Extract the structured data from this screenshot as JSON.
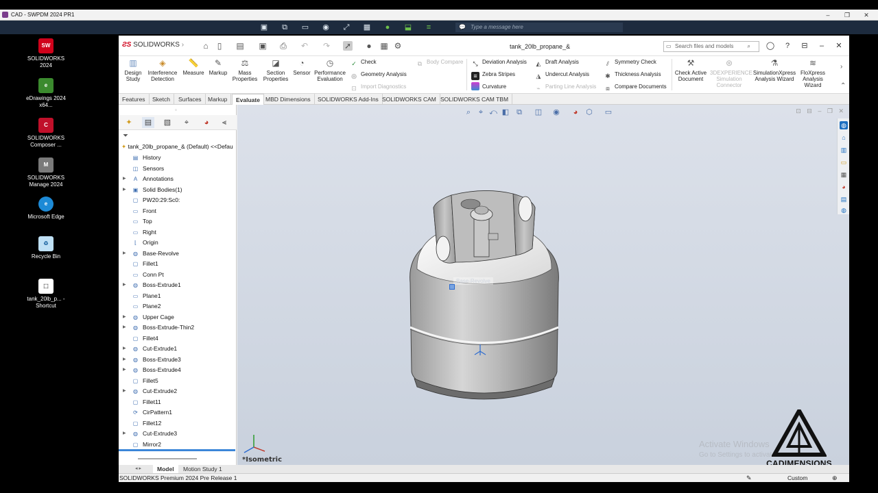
{
  "remote": {
    "title": "CAD - SWPDM 2024 PR1",
    "message_placeholder": "Type a message here"
  },
  "desktop": {
    "icons": [
      {
        "label": "SOLIDWORKS 2024",
        "icon": "solidworks-icon",
        "color": "#d0021b"
      },
      {
        "label": "eDrawings 2024 x64...",
        "icon": "edrawings-icon",
        "color": "#3b8a2e"
      },
      {
        "label": "SOLIDWORKS Composer ...",
        "icon": "composer-icon",
        "color": "#c0102a"
      },
      {
        "label": "SOLIDWORKS Manage 2024",
        "icon": "manage-icon",
        "color": "#7a7a7a"
      },
      {
        "label": "Microsoft Edge",
        "icon": "edge-icon",
        "color": "#1d8ad6"
      },
      {
        "label": "Recycle Bin",
        "icon": "recycle-bin-icon",
        "color": "#bfe0f5"
      },
      {
        "label": "tank_20lb_p... - Shortcut",
        "icon": "shortcut-icon",
        "color": "#ffffff"
      }
    ]
  },
  "sw": {
    "brand": "SOLIDWORKS",
    "doc_title": "tank_20lb_propane_&",
    "search_placeholder": "Search files and models",
    "ribbon": {
      "large": [
        {
          "label": "Design Study",
          "icon": "design-study-icon"
        },
        {
          "label": "Interference Detection",
          "icon": "interference-icon"
        },
        {
          "label": "Measure",
          "icon": "measure-icon"
        },
        {
          "label": "Markup",
          "icon": "markup-icon"
        },
        {
          "label": "Mass Properties",
          "icon": "mass-properties-icon"
        },
        {
          "label": "Section Properties",
          "icon": "section-properties-icon"
        },
        {
          "label": "Sensor",
          "icon": "sensor-icon"
        },
        {
          "label": "Performance Evaluation",
          "icon": "performance-icon"
        }
      ],
      "col1": [
        "Check",
        "Geometry Analysis",
        "Import Diagnostics"
      ],
      "col_dis": "Body Compare",
      "col2": [
        "Deviation Analysis",
        "Zebra Stripes",
        "Curvature"
      ],
      "col3": [
        "Draft Analysis",
        "Undercut Analysis",
        "Parting Line Analysis"
      ],
      "col4": [
        "Symmetry Check",
        "Thickness Analysis",
        "Compare Documents"
      ],
      "right": [
        {
          "label": "Check Active Document",
          "icon": "check-active-icon"
        },
        {
          "label": "3DEXPERIENCE Simulation Connector",
          "icon": "3dx-icon"
        },
        {
          "label": "SimulationXpress Analysis Wizard",
          "icon": "simxpress-icon"
        },
        {
          "label": "FloXpress Analysis Wizard",
          "icon": "floxpress-icon"
        }
      ]
    },
    "cm_tabs": [
      "Features",
      "Sketch",
      "Surfaces",
      "Markup",
      "Evaluate",
      "MBD Dimensions",
      "SOLIDWORKS Add-Ins",
      "SOLIDWORKS CAM",
      "SOLIDWORKS CAM TBM"
    ],
    "tree_root": "tank_20lb_propane_& (Default) <<Defau",
    "tree": [
      {
        "label": "History",
        "exp": false
      },
      {
        "label": "Sensors",
        "exp": false
      },
      {
        "label": "Annotations",
        "exp": true
      },
      {
        "label": "Solid Bodies(1)",
        "exp": true
      },
      {
        "label": "PW20:29:Sc0:",
        "exp": false
      },
      {
        "label": "Front",
        "exp": false
      },
      {
        "label": "Top",
        "exp": false
      },
      {
        "label": "Right",
        "exp": false
      },
      {
        "label": "Origin",
        "exp": false
      },
      {
        "label": "Base-Revolve",
        "exp": true
      },
      {
        "label": "Fillet1",
        "exp": false
      },
      {
        "label": "Conn Pt",
        "exp": false
      },
      {
        "label": "Boss-Extrude1",
        "exp": true
      },
      {
        "label": "Plane1",
        "exp": false
      },
      {
        "label": "Plane2",
        "exp": false
      },
      {
        "label": "Upper Cage",
        "exp": true
      },
      {
        "label": "Boss-Extrude-Thin2",
        "exp": true
      },
      {
        "label": "Fillet4",
        "exp": false
      },
      {
        "label": "Cut-Extrude1",
        "exp": true
      },
      {
        "label": "Boss-Extrude3",
        "exp": true
      },
      {
        "label": "Boss-Extrude4",
        "exp": true
      },
      {
        "label": "Fillet5",
        "exp": false
      },
      {
        "label": "Cut-Extrude2",
        "exp": true
      },
      {
        "label": "Fillet11",
        "exp": false
      },
      {
        "label": "CirPattern1",
        "exp": false
      },
      {
        "label": "Fillet12",
        "exp": false
      },
      {
        "label": "Cut-Extrude3",
        "exp": true
      },
      {
        "label": "Mirror2",
        "exp": false
      }
    ],
    "view_label": "*Isometric",
    "tooltip": "Base-Revolve",
    "watermark_line1": "Activate Windows",
    "watermark_line2": "Go to Settings to activate",
    "bottom_tabs": [
      "Model",
      "Motion Study 1"
    ],
    "status_text": "SOLIDWORKS Premium 2024 Pre Release 1",
    "units": "Custom",
    "cad_logo": "CADIMENSIONS"
  }
}
